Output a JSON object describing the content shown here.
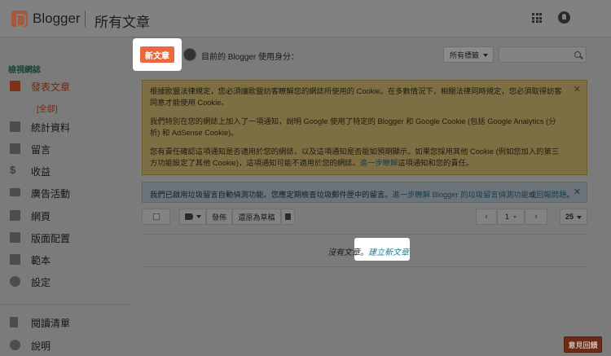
{
  "header": {
    "brand": "Blogger",
    "page_title": "所有文章"
  },
  "sidebar": {
    "view_blog": "檢視網誌",
    "items": [
      {
        "label": "發表文章",
        "icon": "posts-icon",
        "active": true
      },
      {
        "label": "統計資料",
        "icon": "stats-icon"
      },
      {
        "label": "留言",
        "icon": "comments-icon"
      },
      {
        "label": "收益",
        "icon": "earnings-icon"
      },
      {
        "label": "廣告活動",
        "icon": "campaigns-icon"
      },
      {
        "label": "網頁",
        "icon": "pages-icon"
      },
      {
        "label": "版面配置",
        "icon": "layout-icon"
      },
      {
        "label": "範本",
        "icon": "theme-icon"
      },
      {
        "label": "設定",
        "icon": "settings-icon"
      },
      {
        "label": "閱讀清單",
        "icon": "reading-list-icon"
      },
      {
        "label": "說明",
        "icon": "help-icon"
      }
    ],
    "sub_item": "[全部]"
  },
  "main": {
    "new_post": "新文章",
    "identity": "目前的 Blogger 使用身分：",
    "labels_dropdown": "所有標籤",
    "search_placeholder": "",
    "cookie_notice": {
      "p1": "根據歐盟法律規定，您必須讓歐盟訪客瞭解您的網誌所使用的 Cookie。在多數情況下，相關法律同時規定，您必須取得訪客同意才能使用 Cookie。",
      "p2": "我們特別在您的網誌上加入了一項通知，說明 Google 使用了特定的 Blogger 和 Google Cookie (包括 Google Analytics (分析) 和 AdSense Cookie)。",
      "p3_pre": "您有責任確認這項通知是否適用於您的網誌，以及這項通知是否能如預期顯示。如果您採用其他 Cookie (例如您加入的第三方功能設定了其他 Cookie)，這項通知可能不適用於您的網誌。",
      "p3_link": "進一步瞭解",
      "p3_post": "這項通知和您的責任。"
    },
    "spam_notice": {
      "text": "我們已啟用垃圾留言自動偵測功能。您應定期檢查垃圾郵件匣中的留言。",
      "link1": "進一步瞭解 Blogger 的垃圾留言偵測功能",
      "mid": "或",
      "link2": "回報問題",
      "end": "。"
    },
    "toolbar": {
      "publish": "發佈",
      "revert": "還原為草稿",
      "page": "1",
      "per_page": "25"
    },
    "empty": {
      "text": "沒有文章。",
      "link": "建立新文章"
    },
    "feedback": "意見回饋"
  },
  "colors": {
    "accent": "#e8693e",
    "link": "#1a7a8c"
  }
}
